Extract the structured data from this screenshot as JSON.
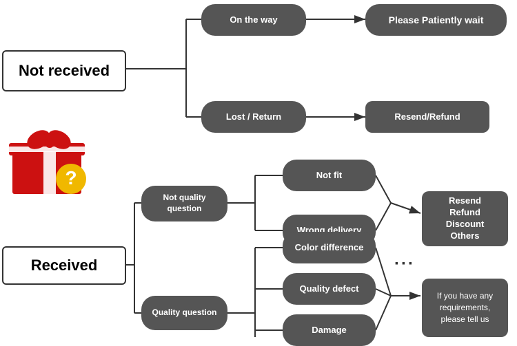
{
  "nodes": {
    "not_received": "Not received",
    "on_the_way": "On the way",
    "please_wait": "Please Patiently wait",
    "lost_return": "Lost / Return",
    "resend_refund": "Resend/Refund",
    "received": "Received",
    "not_quality_question": "Not quality question",
    "quality_question": "Quality question",
    "not_fit": "Not fit",
    "wrong_delivery": "Wrong delivery",
    "color_difference": "Color difference",
    "quality_defect": "Quality defect",
    "damage": "Damage",
    "result_options": "Resend\nRefund\nDiscount\nOthers",
    "contact_us": "If you have any requirements, please tell us"
  },
  "colors": {
    "node_bg": "#555555",
    "node_text": "#ffffff",
    "main_bg": "#ffffff",
    "main_border": "#333333",
    "arrow": "#333333"
  }
}
